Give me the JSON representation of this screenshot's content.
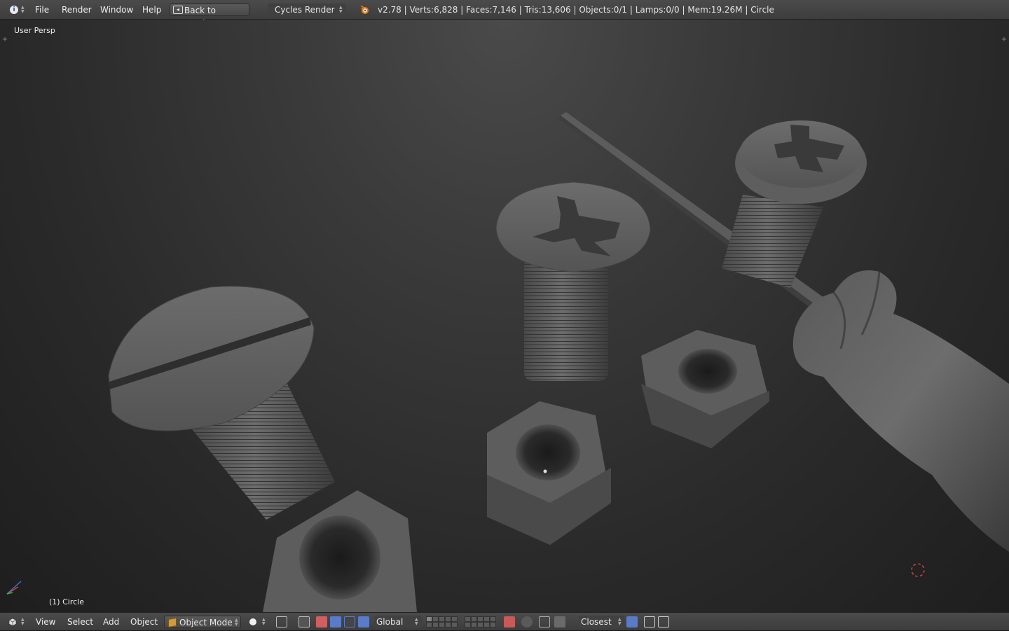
{
  "top_header": {
    "menus": [
      "File",
      "Render",
      "Window",
      "Help"
    ],
    "back_button": "Back to Previous",
    "render_engine": "Cycles Render",
    "stats": "v2.78 | Verts:6,828 | Faces:7,146 | Tris:13,606 | Objects:0/1 | Lamps:0/0 | Mem:19.26M | Circle"
  },
  "viewport": {
    "view_label": "User Persp",
    "object_label": "(1) Circle"
  },
  "bottom_header": {
    "menus": [
      "View",
      "Select",
      "Add",
      "Object"
    ],
    "mode": "Object Mode",
    "orientation": "Global",
    "snap_target": "Closest"
  },
  "colors": {
    "header_bg": "#424242",
    "viewport_top": "#4a4a4a",
    "viewport_bottom": "#1e1e1e",
    "mesh_gray": "#646464",
    "blender_orange": "#e87d0d"
  }
}
